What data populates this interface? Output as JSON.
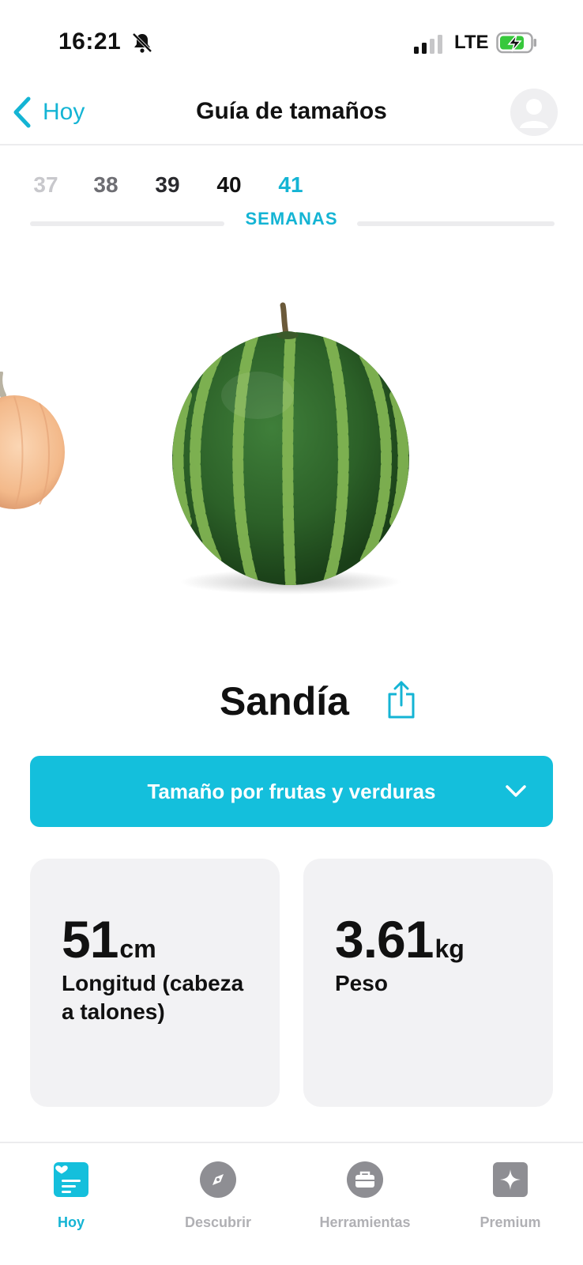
{
  "status_bar": {
    "time": "16:21",
    "network": "LTE"
  },
  "nav": {
    "back_label": "Hoy",
    "title": "Guía de tamaños"
  },
  "weeks": {
    "items": [
      "37",
      "38",
      "39",
      "40",
      "41"
    ],
    "selected": "41",
    "label": "SEMANAS"
  },
  "fruit": {
    "name": "Sandía"
  },
  "size_dropdown": {
    "label": "Tamaño por frutas y verduras"
  },
  "stats": {
    "length": {
      "value": "51",
      "unit": "cm",
      "label": "Longitud (cabeza a talones)"
    },
    "weight": {
      "value": "3.61",
      "unit": "kg",
      "label": "Peso"
    }
  },
  "tabs": [
    {
      "label": "Hoy",
      "icon": "journal-icon",
      "active": true
    },
    {
      "label": "Descubrir",
      "icon": "compass-icon",
      "active": false
    },
    {
      "label": "Herramientas",
      "icon": "briefcase-icon",
      "active": false
    },
    {
      "label": "Premium",
      "icon": "sparkle-icon",
      "active": false
    }
  ],
  "colors": {
    "accent": "#14b4d4",
    "dropdown_bg": "#14bfdc",
    "card_bg": "#f2f2f4",
    "battery": "#37c83c"
  }
}
